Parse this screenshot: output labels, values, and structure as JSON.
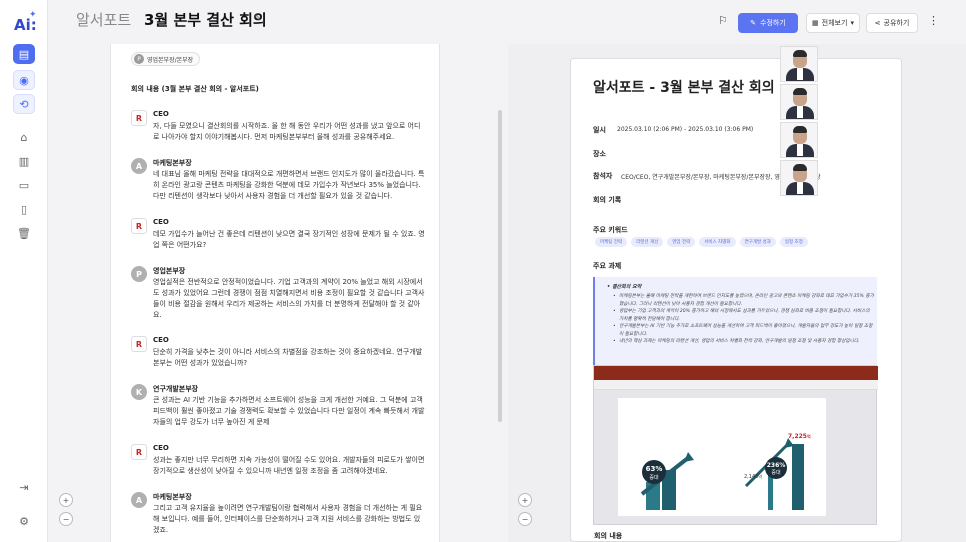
{
  "app": {
    "logo_text": "Ai:"
  },
  "header": {
    "breadcrumb_root": "알서포트",
    "breadcrumb_sep": "—",
    "title": "3월 본부 결산 회의",
    "edit_button": "수정하기",
    "view_button": "전체보기",
    "share_button": "공유하기"
  },
  "transcript": {
    "tag": {
      "initial": "P",
      "label": "영업본부장/본부장"
    },
    "section_title": "회의 내용 (3월 본부 결산 회의 - 알서포트)",
    "messages": [
      {
        "speaker": "CEO",
        "avatar": "ceo",
        "initial": "R",
        "text": "자, 다들 모였으니 결산회의를 시작하죠. 올 한 해 동안 우리가 어떤 성과를 냈고 앞으로 어디로 나아가야 할지 이야기해봅시다. 먼저 마케팅본부부터 올해 성과를 공유해주세요."
      },
      {
        "speaker": "마케팅본부장",
        "avatar": "gray",
        "initial": "A",
        "text": "네 대표님 올해 마케팅 전략을 대대적으로 개편하면서 브랜드 인지도가 많이 올라갔습니다. 특히 온라인 광고랑 콘텐츠 마케팅을 강화한 덕분에 데모 가입수가 작년보다 35% 늘었습니다. 다만 리텐션이 생각보다 낮아서 사용자 경험을 더 개선할 필요가 있을 것 같습니다."
      },
      {
        "speaker": "CEO",
        "avatar": "ceo",
        "initial": "R",
        "text": "데모 가입수가 늘어난 건 좋은데 리텐션이 낮으면 결국 장기적인 성장에 문제가 될 수 있죠. 영업 쪽은 어떤가요?"
      },
      {
        "speaker": "영업본부장",
        "avatar": "gray",
        "initial": "P",
        "text": "영업실적은 전반적으로 안정적이었습니다. 기업 고객과의 계약이 20% 늘었고 해외 시장에서도 성과가 있었어요 그런데 경쟁이 점점 치열해지면서 비용 조정이 필요할 것 같습니다 고객사들이 비용 절감을 원해서 우리가 제공하는 서비스의 가치를 더 분명하게 전달해야 할 것 같아요."
      },
      {
        "speaker": "CEO",
        "avatar": "ceo",
        "initial": "R",
        "text": "단순히 가격을 낮추는 것이 아니라 서비스의 차별점을 강조하는 것이 중요하겠네요. 연구개발본부는 어떤 성과가 있었습니까?"
      },
      {
        "speaker": "연구개발본부장",
        "avatar": "gray",
        "initial": "K",
        "text": "큰 성과는 AI 기반 기능을 추가하면서 소프트웨어 성능을 크게 개선한 거예요. 그 덕분에 고객 피드백이 훨씬 좋아졌고 기술 경쟁력도 확보할 수 있었습니다 다만 일정이 계속 빠듯해서 개발자들의 업무 강도가 너무 높아진 게 문제"
      },
      {
        "speaker": "CEO",
        "avatar": "ceo",
        "initial": "R",
        "text": "성과는 좋지만 너무 무리하면 지속 가능성이 떨어질 수도 있어요. 개발자들의 피로도가 쌓이면 장기적으로 생산성이 낮아질 수 있으니까 내년엔 일정 조정을 좀 고려해야겠네요."
      },
      {
        "speaker": "마케팅본부장",
        "avatar": "gray",
        "initial": "A",
        "text": "그리고 고객 유지율을 높이려면 연구개발팀이랑 협력해서 사용자 경험을 더 개선하는 게 필요해 보입니다. 예를 들어, 인터페이스를 단순화하거나 고객 지원 서비스를 강화하는 방법도 있겠죠."
      }
    ]
  },
  "document": {
    "title": "알서포트 - 3월 본부 결산 회의",
    "date_label": "일시",
    "date_value": "2025.03.10 (2:06 PM) - 2025.03.10 (3:06 PM)",
    "place_label": "장소",
    "attendees_label": "참석자",
    "attendees_value": "CEO/CEO, 연구개발본부장/본부장, 마케팅본부장/본부장장, 영업본부장/본부장",
    "record_label": "회의 기록",
    "keywords_label": "주요 키워드",
    "keywords": [
      "마케팅 전략",
      "리텐션 개선",
      "영업 전략",
      "서비스 차별화",
      "연구개발 성과",
      "일정 조정"
    ],
    "tasks_label": "주요 과제",
    "summary_head": "결산회의 요약",
    "summary_items": [
      "마케팅본부는 올해 마케팅 전략을 개편하여 브랜드 인지도를 높였으며, 온라인 광고와 콘텐츠 마케팅 강화로 데모 가입수가 35% 증가했습니다. 그러나 리텐션이 낮아 사용자 경험 개선이 필요합니다.",
      "영업부는 기업 고객과의 계약이 20% 증가하고 해외 시장에서도 성과를 거두었으나, 경쟁 심화로 비용 조정이 필요합니다. 서비스의 가치를 명확히 전달해야 합니다.",
      "연구개발본부는 AI 기반 기능 추가로 소프트웨어 성능을 개선하여 고객 피드백이 좋아졌으나, 개발자들의 업무 강도가 높아 일정 조정이 필요합니다.",
      "내년의 핵심 과제는 마케팅의 리텐션 개선, 영업의 서비스 차별화 전략 강화, 연구개발의 일정 조정 및 사용자 경험 향상입니다."
    ],
    "bottom_label": "회의 내용"
  },
  "slide_chart": {
    "badge1": "63%",
    "badge1_sub": "증대",
    "badge2": "236%",
    "badge2_sub": "증대",
    "value_small": "2,145",
    "value_small_unit": "억",
    "value_big": "7,225",
    "value_big_unit": "억"
  },
  "colors": {
    "accent": "#5b74f2",
    "slide_red": "#8c2a1c",
    "chart_teal": "#1f5f6e"
  }
}
